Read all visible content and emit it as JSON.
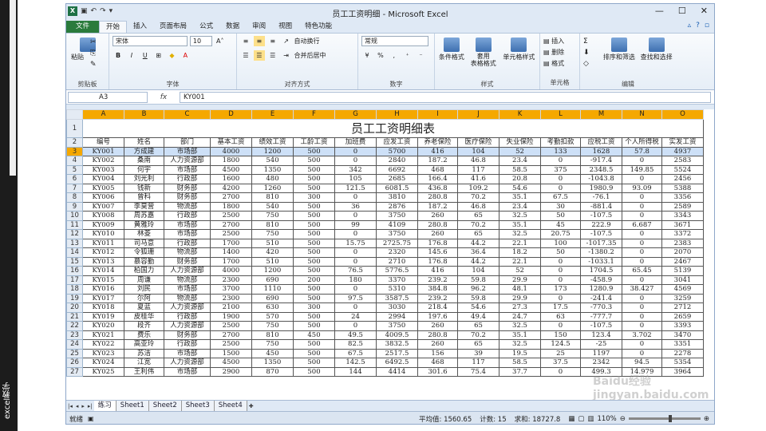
{
  "sidebar_label": "excel教学",
  "title": "员工工资明细 - Microsoft Excel",
  "tabs": [
    "文件",
    "开始",
    "插入",
    "页面布局",
    "公式",
    "数据",
    "审阅",
    "视图",
    "特色功能"
  ],
  "ribbon": {
    "clipboard": {
      "label": "剪贴板",
      "paste": "粘贴"
    },
    "font": {
      "label": "字体",
      "name": "宋体",
      "size": "10",
      "bold": "B",
      "italic": "I",
      "underline": "U"
    },
    "align": {
      "label": "对齐方式",
      "wrap": "自动换行",
      "merge": "合并后居中"
    },
    "number": {
      "label": "数字",
      "format": "常规",
      "percent": "%"
    },
    "styles": {
      "label": "样式",
      "cond": "条件格式",
      "table": "套用\n表格格式",
      "cell": "单元格样式"
    },
    "cells": {
      "label": "单元格",
      "insert": "插入",
      "delete": "删除",
      "format": "格式"
    },
    "edit": {
      "label": "编辑",
      "sort": "排序和筛选",
      "find": "查找和选择"
    }
  },
  "namebox": "A3",
  "formula": "KY001",
  "fx": "fx",
  "columns": [
    "A",
    "B",
    "C",
    "D",
    "E",
    "F",
    "G",
    "H",
    "I",
    "J",
    "K",
    "L",
    "M",
    "N",
    "O"
  ],
  "sheet_title": "员工工资明细表",
  "headers": [
    "编号",
    "姓名",
    "部门",
    "基本工资",
    "绩效工资",
    "工龄工资",
    "加班费",
    "应发工资",
    "养老保险",
    "医疗保险",
    "失业保险",
    "考勤扣款",
    "应税工资",
    "个人所得税",
    "实发工资"
  ],
  "rows": [
    [
      "KY001",
      "方成建",
      "市场部",
      "4000",
      "1200",
      "500",
      "0",
      "5700",
      "416",
      "104",
      "52",
      "133",
      "1628",
      "57.8",
      "4937"
    ],
    [
      "KY002",
      "桑南",
      "人力资源部",
      "1800",
      "540",
      "500",
      "0",
      "2840",
      "187.2",
      "46.8",
      "23.4",
      "0",
      "-917.4",
      "0",
      "2583"
    ],
    [
      "KY003",
      "何宇",
      "市场部",
      "4500",
      "1350",
      "500",
      "342",
      "6692",
      "468",
      "117",
      "58.5",
      "375",
      "2348.5",
      "149.85",
      "5524"
    ],
    [
      "KY004",
      "刘光利",
      "行政部",
      "1600",
      "480",
      "500",
      "105",
      "2685",
      "166.4",
      "41.6",
      "20.8",
      "0",
      "-1043.8",
      "0",
      "2456"
    ],
    [
      "KY005",
      "钱新",
      "财务部",
      "4200",
      "1260",
      "500",
      "121.5",
      "6081.5",
      "436.8",
      "109.2",
      "54.6",
      "0",
      "1980.9",
      "93.09",
      "5388"
    ],
    [
      "KY006",
      "曾科",
      "财务部",
      "2700",
      "810",
      "300",
      "0",
      "3810",
      "280.8",
      "70.2",
      "35.1",
      "67.5",
      "-76.1",
      "0",
      "3356"
    ],
    [
      "KY007",
      "李莫营",
      "物流部",
      "1800",
      "540",
      "500",
      "36",
      "2876",
      "187.2",
      "46.8",
      "23.4",
      "30",
      "-881.4",
      "0",
      "2589"
    ],
    [
      "KY008",
      "周苏嘉",
      "行政部",
      "2500",
      "750",
      "500",
      "0",
      "3750",
      "260",
      "65",
      "32.5",
      "50",
      "-107.5",
      "0",
      "3343"
    ],
    [
      "KY009",
      "黄雅玲",
      "市场部",
      "2700",
      "810",
      "500",
      "99",
      "4109",
      "280.8",
      "70.2",
      "35.1",
      "45",
      "222.9",
      "6.687",
      "3671"
    ],
    [
      "KY010",
      "林菱",
      "市场部",
      "2500",
      "750",
      "500",
      "0",
      "3750",
      "260",
      "65",
      "32.5",
      "20.75",
      "-107.5",
      "0",
      "3372"
    ],
    [
      "KY011",
      "司马意",
      "行政部",
      "1700",
      "510",
      "500",
      "15.75",
      "2725.75",
      "176.8",
      "44.2",
      "22.1",
      "100",
      "-1017.35",
      "0",
      "2383"
    ],
    [
      "KY012",
      "令狐珊",
      "物流部",
      "1400",
      "420",
      "500",
      "0",
      "2320",
      "145.6",
      "36.4",
      "18.2",
      "50",
      "-1380.2",
      "0",
      "2070"
    ],
    [
      "KY013",
      "慕容勤",
      "财务部",
      "1700",
      "510",
      "500",
      "0",
      "2710",
      "176.8",
      "44.2",
      "22.1",
      "0",
      "-1033.1",
      "0",
      "2467"
    ],
    [
      "KY014",
      "柏国力",
      "人力资源部",
      "4000",
      "1200",
      "500",
      "76.5",
      "5776.5",
      "416",
      "104",
      "52",
      "0",
      "1704.5",
      "65.45",
      "5139"
    ],
    [
      "KY015",
      "周谦",
      "物流部",
      "2300",
      "690",
      "200",
      "180",
      "3370",
      "239.2",
      "59.8",
      "29.9",
      "0",
      "-458.9",
      "0",
      "3041"
    ],
    [
      "KY016",
      "刘民",
      "市场部",
      "3700",
      "1110",
      "500",
      "0",
      "5310",
      "384.8",
      "96.2",
      "48.1",
      "173",
      "1280.9",
      "38.427",
      "4569"
    ],
    [
      "KY017",
      "尔阿",
      "物流部",
      "2300",
      "690",
      "500",
      "97.5",
      "3587.5",
      "239.2",
      "59.8",
      "29.9",
      "0",
      "-241.4",
      "0",
      "3259"
    ],
    [
      "KY018",
      "夏蓝",
      "人力资源部",
      "2100",
      "630",
      "300",
      "0",
      "3030",
      "218.4",
      "54.6",
      "27.3",
      "17.5",
      "-770.3",
      "0",
      "2712"
    ],
    [
      "KY019",
      "皮桂华",
      "行政部",
      "1900",
      "570",
      "500",
      "24",
      "2994",
      "197.6",
      "49.4",
      "24.7",
      "63",
      "-777.7",
      "0",
      "2659"
    ],
    [
      "KY020",
      "段齐",
      "人力资源部",
      "2500",
      "750",
      "500",
      "0",
      "3750",
      "260",
      "65",
      "32.5",
      "0",
      "-107.5",
      "0",
      "3393"
    ],
    [
      "KY021",
      "费乐",
      "财务部",
      "2700",
      "810",
      "450",
      "49.5",
      "4009.5",
      "280.8",
      "70.2",
      "35.1",
      "150",
      "123.4",
      "3.702",
      "3470"
    ],
    [
      "KY022",
      "高亚玲",
      "行政部",
      "2500",
      "750",
      "500",
      "82.5",
      "3832.5",
      "260",
      "65",
      "32.5",
      "124.5",
      "-25",
      "0",
      "3351"
    ],
    [
      "KY023",
      "苏洁",
      "市场部",
      "1500",
      "450",
      "500",
      "67.5",
      "2517.5",
      "156",
      "39",
      "19.5",
      "25",
      "1197",
      "0",
      "2278"
    ],
    [
      "KY024",
      "江宽",
      "人力资源部",
      "4500",
      "1350",
      "500",
      "142.5",
      "6492.5",
      "468",
      "117",
      "58.5",
      "37.5",
      "2342",
      "94.5",
      "5354"
    ],
    [
      "KY025",
      "王利伟",
      "市场部",
      "2900",
      "870",
      "500",
      "144",
      "4414",
      "301.6",
      "75.4",
      "37.7",
      "0",
      "499.3",
      "14.979",
      "3964"
    ]
  ],
  "sheets": [
    "练习",
    "Sheet1",
    "Sheet2",
    "Sheet3",
    "Sheet4"
  ],
  "status": {
    "ready": "就绪",
    "avg": "平均值: 1560.65",
    "count": "计数: 15",
    "sum": "求和: 18727.8",
    "zoom": "110%"
  },
  "watermark": "Baidu经验 jingyan.baidu.com"
}
